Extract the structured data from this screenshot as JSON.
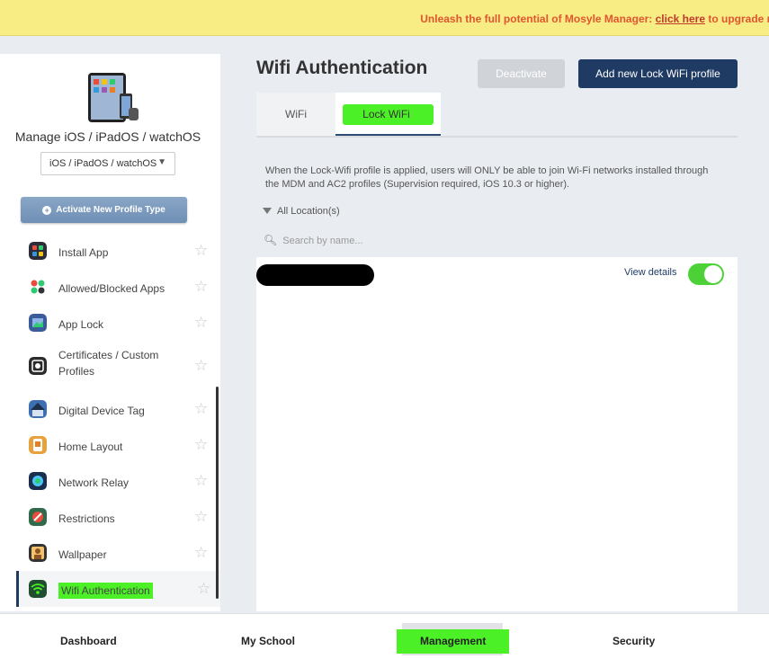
{
  "banner": {
    "prefix": "Unleash the full potential of Mosyle Manager: ",
    "link": "click here",
    "suffix": " to upgrade n"
  },
  "sidebar": {
    "title": "Manage iOS / iPadOS / watchOS",
    "os_select": "iOS / iPadOS / watchOS",
    "activate_button": "Activate New Profile Type",
    "items": [
      {
        "label": "Install App",
        "icon": "install-app-icon",
        "color": "#2d2d3a"
      },
      {
        "label": "Allowed/Blocked Apps",
        "icon": "allowed-blocked-apps-icon",
        "color": "#3a3a3a"
      },
      {
        "label": "App Lock",
        "icon": "app-lock-icon",
        "color": "#3b5b9a"
      },
      {
        "label": "Certificates / Custom Profiles",
        "icon": "certificates-icon",
        "color": "#2b2b2b"
      },
      {
        "label": "Digital Device Tag",
        "icon": "digital-device-tag-icon",
        "color": "#3e6fb0"
      },
      {
        "label": "Home Layout",
        "icon": "home-layout-icon",
        "color": "#e6a23c"
      },
      {
        "label": "Network Relay",
        "icon": "network-relay-icon",
        "color": "#1a2f4f"
      },
      {
        "label": "Restrictions",
        "icon": "restrictions-icon",
        "color": "#2f6b4a"
      },
      {
        "label": "Wallpaper",
        "icon": "wallpaper-icon",
        "color": "#333"
      },
      {
        "label": "Wifi Authentication",
        "icon": "wifi-icon",
        "color": "#1f4f2f"
      }
    ]
  },
  "main": {
    "title": "Wifi Authentication",
    "deactivate_button": "Deactivate",
    "add_button": "Add new Lock WiFi profile",
    "tabs": [
      {
        "label": "WiFi"
      },
      {
        "label": "Lock WiFi"
      }
    ],
    "description": "When the Lock-Wifi profile is applied, users will ONLY be able to join Wi-Fi networks installed through the MDM and AC2 profiles (Supervision required, iOS 10.3 or higher).",
    "filter_label": "All Location(s)",
    "search_placeholder": "Search by name...",
    "profile": {
      "view_details": "View details",
      "enabled": true
    }
  },
  "bottom_nav": {
    "items": [
      "Dashboard",
      "My School",
      "Management",
      "Security"
    ]
  }
}
